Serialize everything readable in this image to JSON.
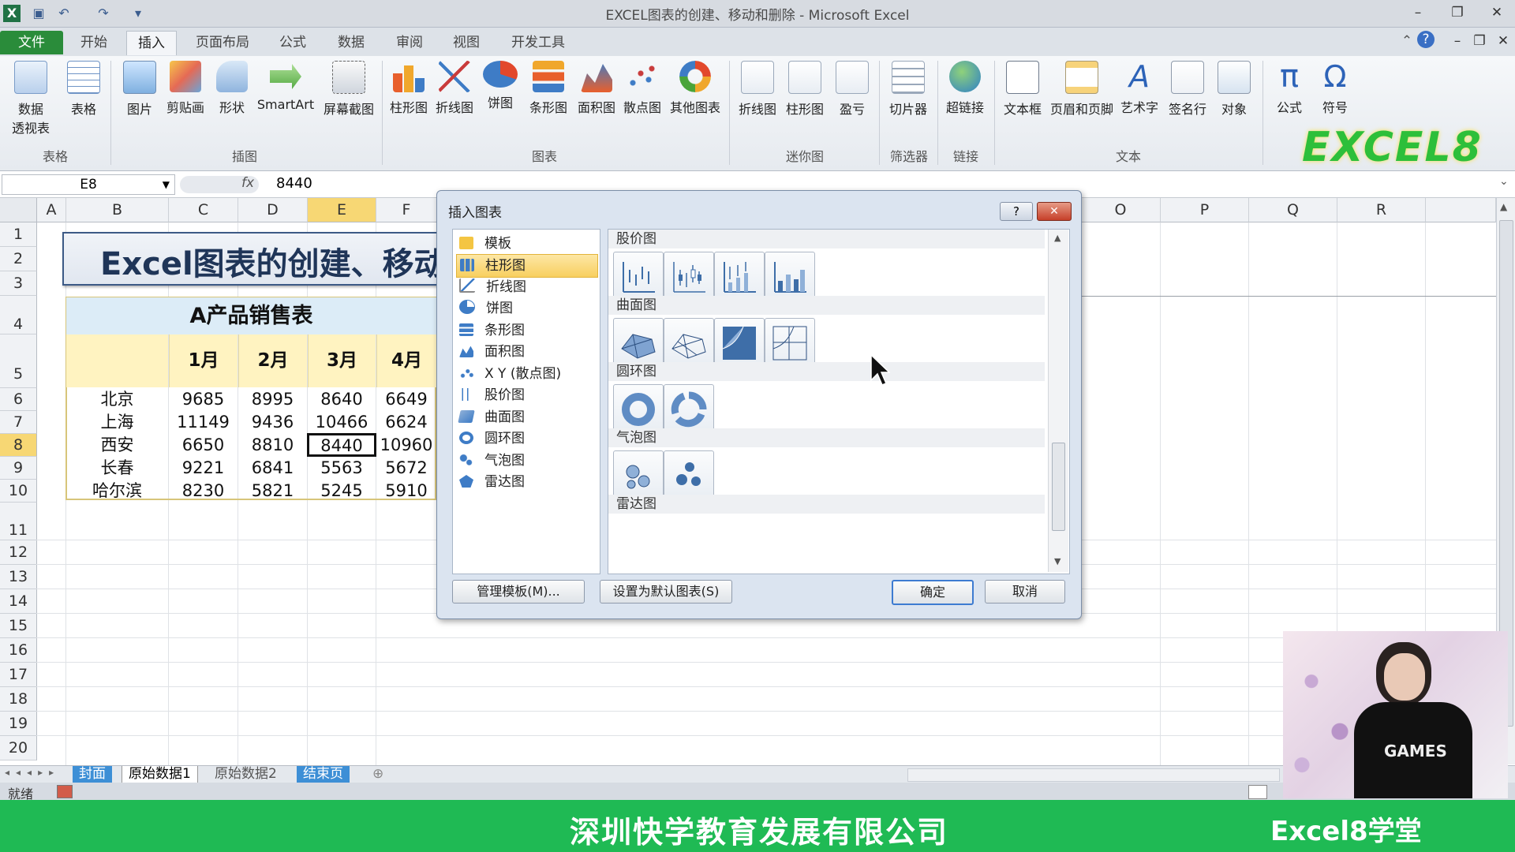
{
  "window": {
    "title": "EXCEL图表的创建、移动和删除 - Microsoft Excel"
  },
  "tabs": [
    {
      "label": "文件"
    },
    {
      "label": "开始"
    },
    {
      "label": "插入"
    },
    {
      "label": "页面布局"
    },
    {
      "label": "公式"
    },
    {
      "label": "数据"
    },
    {
      "label": "审阅"
    },
    {
      "label": "视图"
    },
    {
      "label": "开发工具"
    }
  ],
  "ribbon": {
    "buttons": [
      "数据",
      "透视表",
      "表格",
      "图片",
      "剪贴画",
      "形状",
      "SmartArt",
      "屏幕截图",
      "柱形图",
      "折线图",
      "饼图",
      "条形图",
      "面积图",
      "散点图",
      "其他图表",
      "折线图",
      "柱形图",
      "盈亏",
      "切片器",
      "超链接",
      "文本框",
      "页眉和页脚",
      "艺术字",
      "签名行",
      "对象",
      "公式",
      "符号"
    ],
    "groups": [
      "表格",
      "插图",
      "图表",
      "迷你图",
      "筛选器",
      "链接",
      "文本"
    ],
    "watermark": "EXCEL8"
  },
  "formula_bar": {
    "name_box": "E8",
    "fx": "fx",
    "value": "8440"
  },
  "sheet": {
    "columns": [
      "A",
      "B",
      "C",
      "D",
      "E",
      "F",
      "O",
      "P",
      "Q",
      "R"
    ],
    "rows": [
      "1",
      "2",
      "3",
      "4",
      "5",
      "6",
      "7",
      "8",
      "9",
      "10",
      "11",
      "12",
      "13",
      "14",
      "15",
      "16",
      "17",
      "18",
      "19",
      "20"
    ],
    "banner_text": "Excel图表的创建、移动",
    "table_title": "A产品销售表",
    "months": [
      "1月",
      "2月",
      "3月",
      "4月"
    ],
    "data": [
      {
        "city": "北京",
        "v": [
          "9685",
          "8995",
          "8640",
          "6649"
        ]
      },
      {
        "city": "上海",
        "v": [
          "11149",
          "9436",
          "10466",
          "6624"
        ]
      },
      {
        "city": "西安",
        "v": [
          "6650",
          "8810",
          "8440",
          "10960"
        ]
      },
      {
        "city": "长春",
        "v": [
          "9221",
          "6841",
          "5563",
          "5672"
        ]
      },
      {
        "city": "哈尔滨",
        "v": [
          "8230",
          "5821",
          "5245",
          "5910"
        ]
      }
    ]
  },
  "dialog": {
    "title": "插入图表",
    "help": "?",
    "close": "✕",
    "types": [
      {
        "label": "模板"
      },
      {
        "label": "柱形图"
      },
      {
        "label": "折线图"
      },
      {
        "label": "饼图"
      },
      {
        "label": "条形图"
      },
      {
        "label": "面积图"
      },
      {
        "label": "X Y (散点图)"
      },
      {
        "label": "股价图"
      },
      {
        "label": "曲面图"
      },
      {
        "label": "圆环图"
      },
      {
        "label": "气泡图"
      },
      {
        "label": "雷达图"
      }
    ],
    "selected_type": "柱形图",
    "sections": [
      "股价图",
      "曲面图",
      "圆环图",
      "气泡图",
      "雷达图"
    ],
    "buttons": {
      "manage": "管理模板(M)...",
      "set_default": "设置为默认图表(S)",
      "ok": "确定",
      "cancel": "取消"
    }
  },
  "sheet_tabs": [
    "封面",
    "原始数据1",
    "原始数据2",
    "结束页"
  ],
  "status": {
    "ready": "就绪"
  },
  "footer": {
    "company": "深圳快学教育发展有限公司",
    "brand": "Excel8学堂"
  },
  "webcam": {
    "shirt_text": "GAMES"
  }
}
